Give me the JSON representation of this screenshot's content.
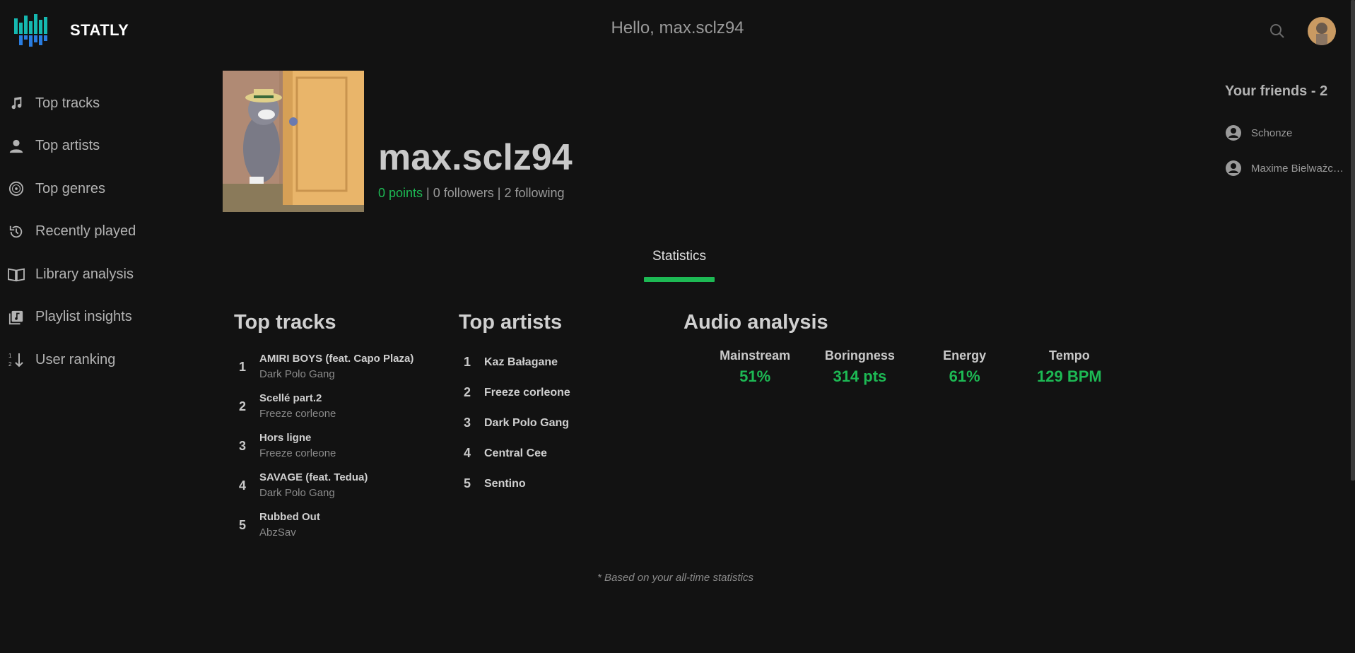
{
  "app": {
    "name": "STATLY",
    "greeting": "Hello, max.sclz94",
    "brand_color": "#1db954",
    "logo_colors": [
      "#15b8b0",
      "#2a7de0"
    ]
  },
  "sidebar": {
    "items": [
      {
        "label": "Top tracks",
        "icon": "music-note-icon"
      },
      {
        "label": "Top artists",
        "icon": "person-icon"
      },
      {
        "label": "Top genres",
        "icon": "vinyl-disc-icon"
      },
      {
        "label": "Recently played",
        "icon": "history-icon"
      },
      {
        "label": "Library analysis",
        "icon": "book-icon"
      },
      {
        "label": "Playlist insights",
        "icon": "playlist-icon"
      },
      {
        "label": "User ranking",
        "icon": "sort-ranking-icon"
      }
    ]
  },
  "profile": {
    "username": "max.sclz94",
    "points": "0 points",
    "separator": " | ",
    "followers": "0 followers",
    "following": "2 following"
  },
  "friends": {
    "title": "Your friends - 2",
    "items": [
      {
        "name": "Schonze"
      },
      {
        "name": "Maxime Bielważcz..."
      }
    ]
  },
  "tabs": [
    {
      "label": "Statistics",
      "active": true
    }
  ],
  "top_tracks": {
    "title": "Top tracks",
    "items": [
      {
        "rank": "1",
        "title": "AMIRI BOYS (feat. Capo Plaza)",
        "artist": "Dark Polo Gang"
      },
      {
        "rank": "2",
        "title": "Scellé part.2",
        "artist": "Freeze corleone"
      },
      {
        "rank": "3",
        "title": "Hors ligne",
        "artist": "Freeze corleone"
      },
      {
        "rank": "4",
        "title": "SAVAGE (feat. Tedua)",
        "artist": "Dark Polo Gang"
      },
      {
        "rank": "5",
        "title": "Rubbed Out",
        "artist": "AbzSav"
      }
    ]
  },
  "top_artists": {
    "title": "Top artists",
    "items": [
      {
        "rank": "1",
        "name": "Kaz Bałagane"
      },
      {
        "rank": "2",
        "name": "Freeze corleone"
      },
      {
        "rank": "3",
        "name": "Dark Polo Gang"
      },
      {
        "rank": "4",
        "name": "Central Cee"
      },
      {
        "rank": "5",
        "name": "Sentino"
      }
    ]
  },
  "audio_analysis": {
    "title": "Audio analysis",
    "stats": [
      {
        "label": "Mainstream",
        "value": "51%"
      },
      {
        "label": "Boringness",
        "value": "314 pts"
      },
      {
        "label": "Energy",
        "value": "61%"
      },
      {
        "label": "Tempo",
        "value": "129 BPM"
      }
    ]
  },
  "footnote": "* Based on your all-time statistics"
}
